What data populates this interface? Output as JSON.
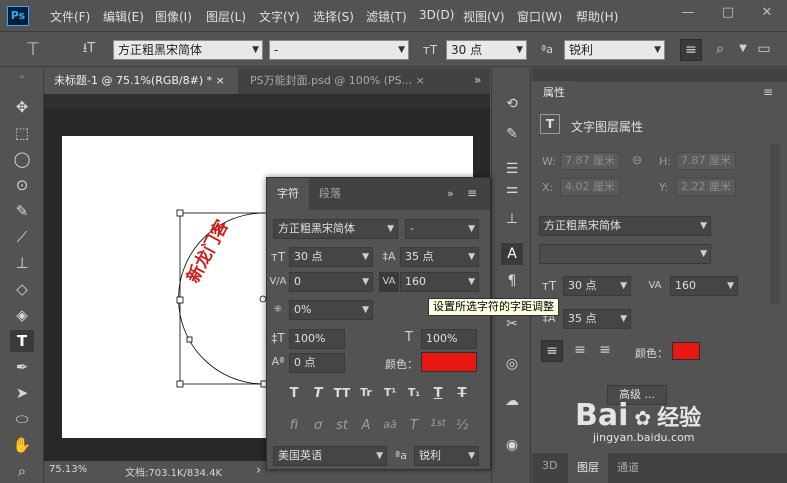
{
  "app": {
    "logo": "Ps"
  },
  "menu": [
    "文件(F)",
    "编辑(E)",
    "图像(I)",
    "图层(L)",
    "文字(Y)",
    "选择(S)",
    "滤镜(T)",
    "3D(D)",
    "视图(V)",
    "窗口(W)",
    "帮助(H)"
  ],
  "window_controls": {
    "minimize": "—",
    "maximize": "□",
    "close": "✕"
  },
  "options": {
    "tool_glyph": "T",
    "orient_glyph": "⭳T",
    "font_family": "方正粗黑宋简体",
    "font_style": "-",
    "size_glyph": "тT",
    "font_size": "30 点",
    "aa_glyph": "ªa",
    "anti_alias": "锐利"
  },
  "tabs": [
    {
      "label": "未标题-1 @ 75.1%(RGB/8#) *",
      "close": "×"
    },
    {
      "label": "PS万能封面.psd @ 100% (PS...",
      "close": "×"
    }
  ],
  "tab_more": "»",
  "canvas": {
    "arc_text": "新龙门客"
  },
  "status": {
    "zoom": "75.13%",
    "doc": "文档:703.1K/834.4K",
    "arrow": "›"
  },
  "char_panel": {
    "tab_char": "字符",
    "tab_para": "段落",
    "font_family": "方正粗黑宋简体",
    "font_style": "-",
    "size": "30 点",
    "leading": "35 点",
    "kerning": "0",
    "tracking": "160",
    "scale_pct": "0%",
    "vscale": "100%",
    "hscale": "100%",
    "baseline": "0 点",
    "color_label": "颜色：",
    "color": "#e8170f",
    "language": "美国英语",
    "anti_alias": "锐利",
    "aa_glyph": "ªa",
    "type_buttons": [
      "T",
      "T",
      "TT",
      "Tr",
      "T¹",
      "T₁",
      "T",
      "T"
    ],
    "otype_buttons": [
      "fi",
      "ơ",
      "st",
      "A",
      "aā",
      "T",
      "1st",
      "½"
    ]
  },
  "tooltip": "设置所选字符的字距调整",
  "properties": {
    "tab": "属性",
    "title": "文字图层属性",
    "w_label": "W:",
    "w_value": "7.87 厘米",
    "h_label": "H:",
    "h_value": "7.87 厘米",
    "x_label": "X:",
    "x_value": "4.02 厘米",
    "y_label": "Y:",
    "y_value": "2.22 厘米",
    "font_family": "方正粗黑宋简体",
    "size": "30 点",
    "tracking": "160",
    "leading": "35 点",
    "color_label": "颜色：",
    "color": "#e8170f",
    "advanced": "高级 ..."
  },
  "bottom_tabs": [
    "3D",
    "图层",
    "通道"
  ],
  "watermark": {
    "brand": "Bai",
    "brand2": "经验",
    "url": "jingyan.baidu.com"
  }
}
